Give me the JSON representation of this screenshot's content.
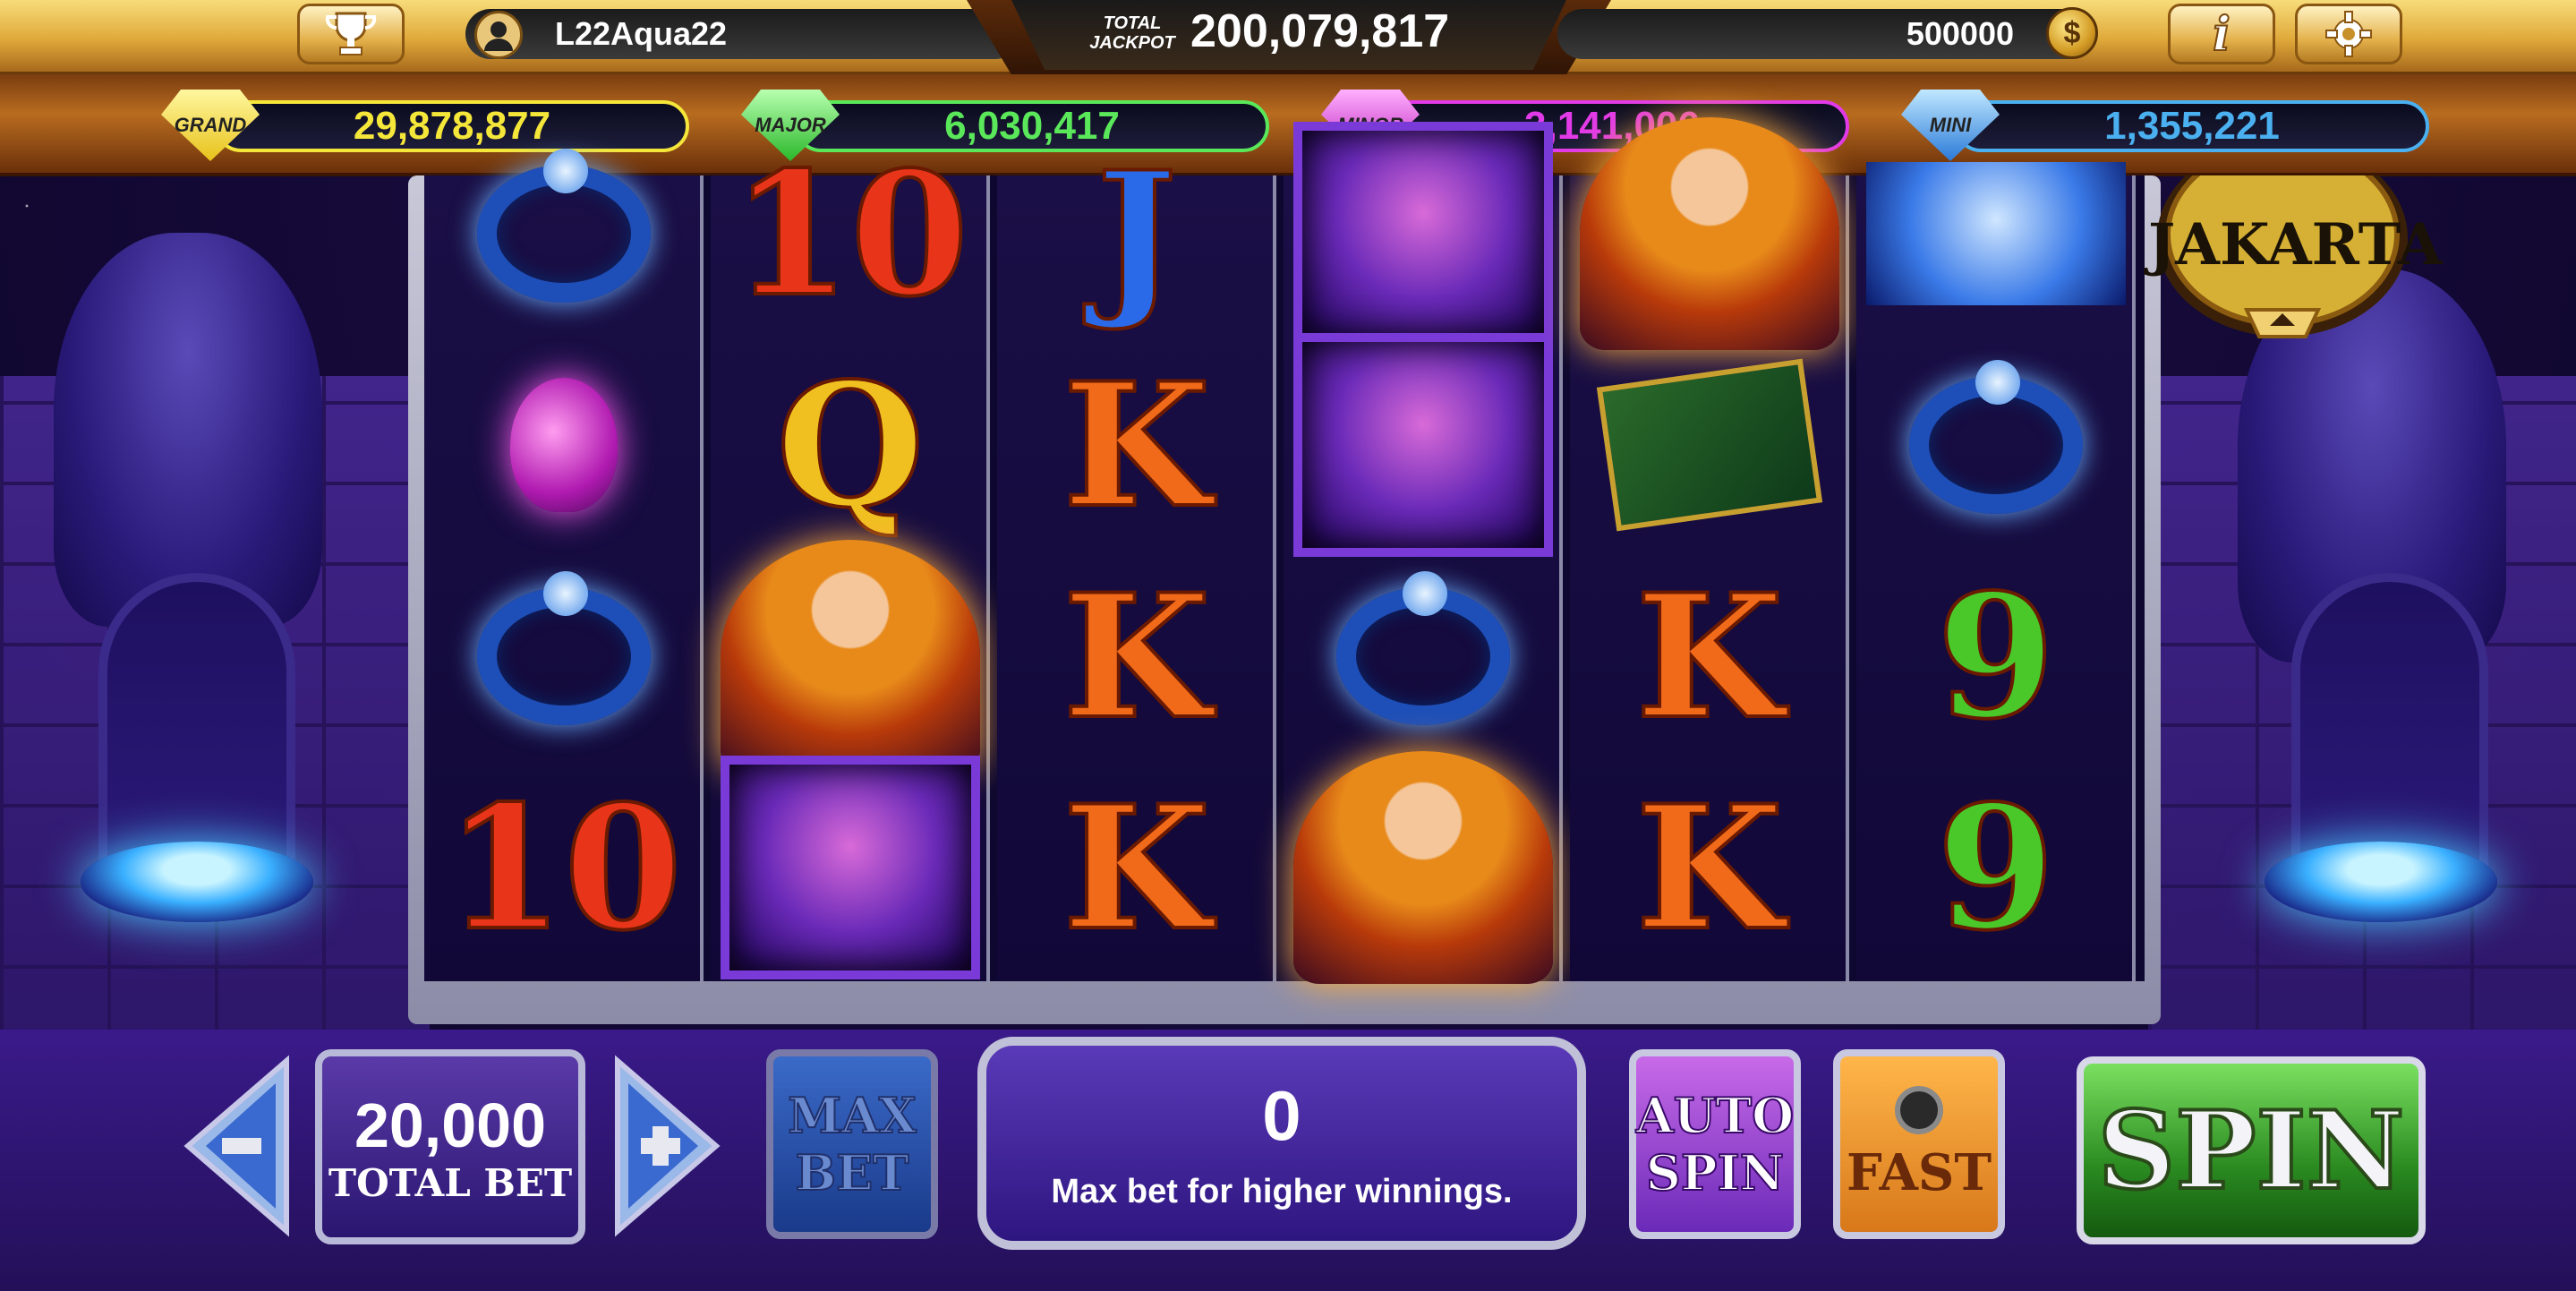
{
  "player": {
    "name": "L22Aqua22",
    "coins": "500000"
  },
  "total_jackpot": {
    "label": "TOTAL JACKPOT",
    "value": "200,079,817"
  },
  "jackpots": [
    {
      "tier": "GRAND",
      "value": "29,878,877",
      "color": "#f5e63a"
    },
    {
      "tier": "MAJOR",
      "value": "6,030,417",
      "color": "#5ae85a"
    },
    {
      "tier": "MINOR",
      "value": "3,141,006",
      "color": "#e23ae8"
    },
    {
      "tier": "MINI",
      "value": "1,355,221",
      "color": "#4ab0f0"
    }
  ],
  "machine_name": "JAKARTA",
  "reels": [
    [
      "ring",
      "potion",
      "ring",
      "10"
    ],
    [
      "10",
      "Q",
      "heroine",
      "bird"
    ],
    [
      "J",
      "K",
      "K",
      "K"
    ],
    [
      "bird",
      "bird",
      "ring",
      "heroine"
    ],
    [
      "heroine",
      "book",
      "K",
      "K"
    ],
    [
      "tiger",
      "ring",
      "9",
      "9"
    ]
  ],
  "controls": {
    "total_bet_value": "20,000",
    "total_bet_label": "TOTAL BET",
    "max_bet_label_1": "MAX",
    "max_bet_label_2": "BET",
    "win_amount": "0",
    "message": "Max bet for higher winnings.",
    "auto_spin_label_1": "AUTO",
    "auto_spin_label_2": "SPIN",
    "fast_label": "FAST",
    "spin_label": "SPIN",
    "coin_symbol": "$",
    "info_symbol": "i"
  }
}
